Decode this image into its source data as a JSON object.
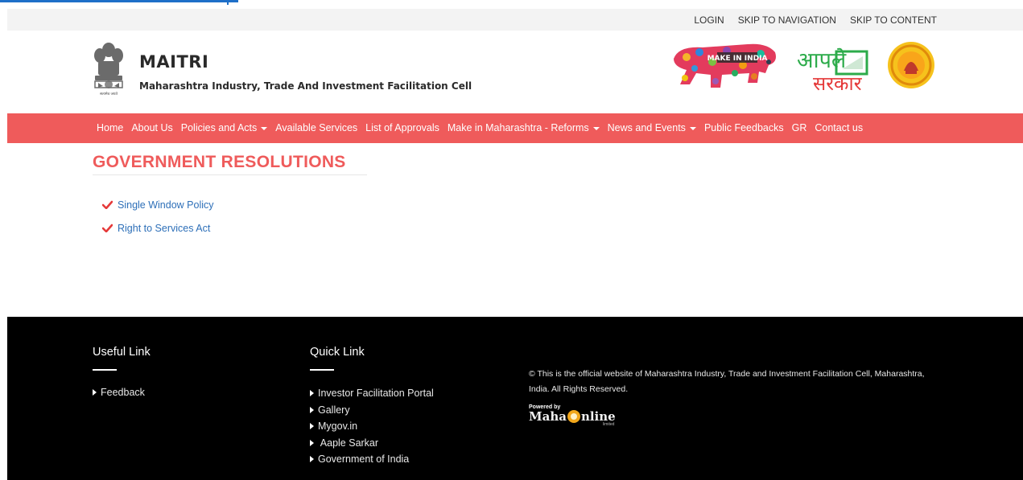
{
  "topbar": {
    "login": "LOGIN",
    "skip_nav": "SKIP TO NAVIGATION",
    "skip_content": "SKIP TO CONTENT"
  },
  "header": {
    "title": "MAITRI",
    "subtitle": "Maharashtra Industry, Trade And Investment Facilitation Cell",
    "emblem_caption": "सत्यमेव जयते",
    "make_in_india_text": "MAKE IN INDIA",
    "aaple_sarkar_top": "आपले",
    "aaple_sarkar_bottom": "सरकार"
  },
  "nav": {
    "items": [
      {
        "label": "Home",
        "dropdown": false
      },
      {
        "label": "About Us",
        "dropdown": false
      },
      {
        "label": "Policies and Acts",
        "dropdown": true
      },
      {
        "label": "Available Services",
        "dropdown": false
      },
      {
        "label": "List of Approvals",
        "dropdown": false
      },
      {
        "label": "Make in Maharashtra - Reforms",
        "dropdown": true
      },
      {
        "label": "News and Events",
        "dropdown": true
      },
      {
        "label": "Public Feedbacks",
        "dropdown": false
      },
      {
        "label": "GR",
        "dropdown": false
      },
      {
        "label": "Contact us",
        "dropdown": false
      }
    ]
  },
  "main": {
    "title": "GOVERNMENT RESOLUTIONS",
    "items": [
      {
        "label": "Single Window Policy"
      },
      {
        "label": "Right to Services Act"
      }
    ]
  },
  "footer": {
    "useful": {
      "heading": "Useful Link",
      "links": [
        "Feedback"
      ]
    },
    "quick": {
      "heading": "Quick Link",
      "links": [
        "Investor Facilitation Portal",
        "Gallery",
        "Mygov.in",
        " Aaple Sarkar",
        "Government of India"
      ]
    },
    "copyright": "© This is the official website of Maharashtra Industry, Trade and Investment Facilitation Cell, Maharashtra, India. All Rights Reserved.",
    "powered_by": "Powered by",
    "powered_brand_left": "Maha",
    "powered_brand_right": "nline",
    "powered_limited": "limited"
  },
  "colors": {
    "accent": "#ef5b5b",
    "link": "#2d6fb8",
    "footer_bg": "#000000",
    "progress": "#1e6fc8"
  },
  "icons": [
    "check-icon",
    "triangle-right-icon",
    "caret-down-icon",
    "state-emblem-icon"
  ]
}
